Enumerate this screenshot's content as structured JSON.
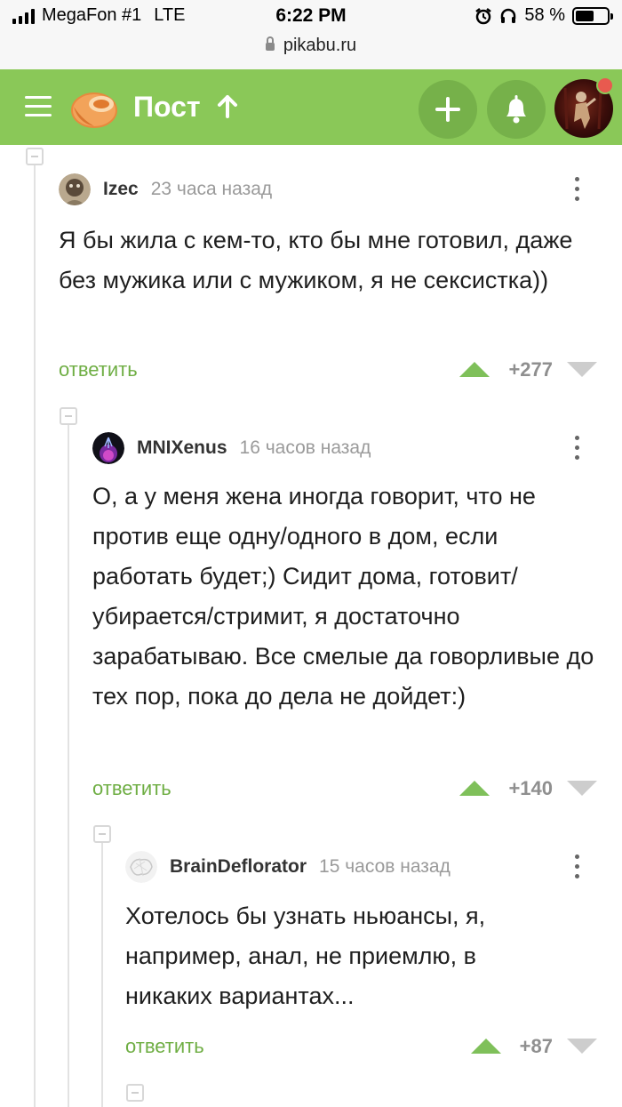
{
  "status_bar": {
    "carrier": "MegaFon #1",
    "network": "LTE",
    "time": "6:22 PM",
    "battery": "58 %",
    "battery_level": 0.58,
    "url": "pikabu.ru"
  },
  "header": {
    "title": "Пост",
    "accent": "#8ac858"
  },
  "comments": [
    {
      "author": "Izec",
      "time": "23 часа назад",
      "text": "Я бы жила с кем-то, кто бы мне готовил, даже без мужика или с мужиком, я не сексистка))",
      "reply": "ответить",
      "rating": "+277"
    },
    {
      "author": "MNIXenus",
      "time": "16 часов назад",
      "text": "О, а у меня жена иногда говорит, что не против еще одну/одного в дом, если работать будет;) Сидит дома, готовит/убирается/стримит, я достаточно зарабатываю. Все смелые да говорливые до тех пор, пока до дела не дойдет:)",
      "reply": "ответить",
      "rating": "+140"
    },
    {
      "author": "BrainDeflorator",
      "time": "15 часов назад",
      "text": "Хотелось бы узнать ньюансы, я, например, анал, не приемлю, в никаких вариантах...",
      "reply": "ответить",
      "rating": "+87"
    }
  ]
}
